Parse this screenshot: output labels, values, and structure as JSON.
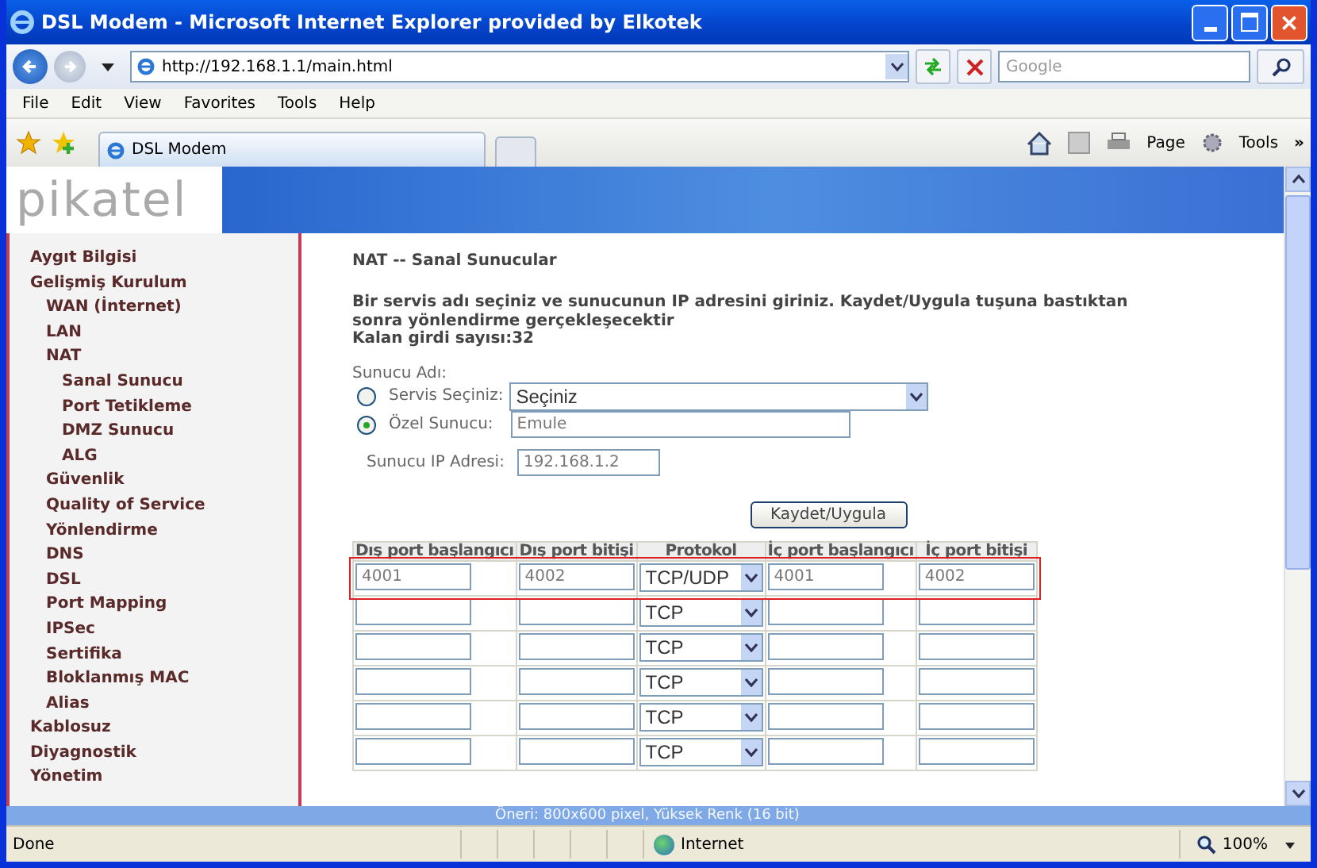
{
  "window": {
    "title": "DSL Modem - Microsoft Internet Explorer provided by Elkotek"
  },
  "address_bar": {
    "url": "http://192.168.1.1/main.html",
    "search_placeholder": "Google"
  },
  "menu": [
    "File",
    "Edit",
    "View",
    "Favorites",
    "Tools",
    "Help"
  ],
  "tabs": [
    {
      "label": "DSL Modem",
      "selected": true
    }
  ],
  "command_bar": {
    "page": "Page",
    "tools": "Tools",
    "more": "»"
  },
  "logo": "pikatel",
  "sidebar": {
    "items": [
      {
        "label": "Aygıt Bilgisi"
      },
      {
        "label": "Gelişmiş Kurulum",
        "children": [
          {
            "label": "WAN (İnternet)"
          },
          {
            "label": "LAN"
          },
          {
            "label": "NAT",
            "children": [
              {
                "label": "Sanal Sunucu"
              },
              {
                "label": "Port Tetikleme"
              },
              {
                "label": "DMZ Sunucu"
              },
              {
                "label": "ALG"
              }
            ]
          },
          {
            "label": "Güvenlik"
          },
          {
            "label": "Quality of Service"
          },
          {
            "label": "Yönlendirme"
          },
          {
            "label": "DNS"
          },
          {
            "label": "DSL"
          },
          {
            "label": "Port Mapping"
          },
          {
            "label": "IPSec"
          },
          {
            "label": "Sertifika"
          },
          {
            "label": "Bloklanmış MAC"
          },
          {
            "label": "Alias"
          }
        ]
      },
      {
        "label": "Kablosuz"
      },
      {
        "label": "Diyagnostik"
      },
      {
        "label": "Yönetim"
      }
    ]
  },
  "content": {
    "heading": "NAT -- Sanal Sunucular",
    "instructions": [
      "Bir servis adı seçiniz ve sunucunun IP adresini giriniz. Kaydet/Uygula tuşuna bastıktan sonra yönlendirme gerçekleşecektir",
      "Kalan girdi sayısı:32"
    ],
    "server_name_label": "Sunucu Adı:",
    "options": [
      {
        "label": "Servis Seçiniz:",
        "selected": false,
        "kind": "select",
        "value": "Seçiniz"
      },
      {
        "label": "Özel Sunucu:",
        "selected": true,
        "kind": "text",
        "value": "Emule"
      }
    ],
    "ip_label": "Sunucu IP Adresi:",
    "ip_value": "192.168.1.2",
    "save_button": "Kaydet/Uygula",
    "table": {
      "columns": [
        "Dış port başlangıcı",
        "Dış port bitişi",
        "Protokol",
        "İç port başlangıcı",
        "İç port bitişi"
      ],
      "rows": [
        {
          "ext_start": "4001",
          "ext_end": "4002",
          "protocol": "TCP/UDP",
          "int_start": "4001",
          "int_end": "4002",
          "highlighted": true
        },
        {
          "protocol": "TCP",
          "highlighted": false
        },
        {
          "protocol": "TCP",
          "highlighted": false
        },
        {
          "protocol": "TCP",
          "highlighted": false
        },
        {
          "protocol": "TCP",
          "highlighted": false
        },
        {
          "protocol": "TCP",
          "highlighted": false
        }
      ]
    }
  },
  "hint_bar": "Öneri: 800x600 pixel, Yüksek Renk (16 bit)",
  "status_bar": {
    "text": "Done",
    "zone": "Internet",
    "zoom": "100%"
  }
}
